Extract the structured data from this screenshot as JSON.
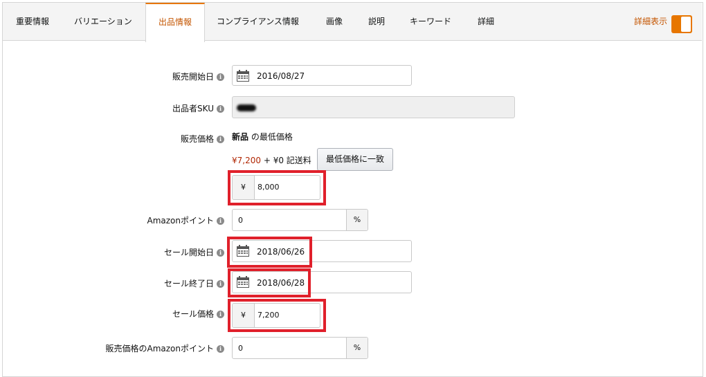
{
  "tabs": [
    {
      "label": "重要情報"
    },
    {
      "label": "バリエーション"
    },
    {
      "label": "出品情報",
      "active": true
    },
    {
      "label": "コンプライアンス情報"
    },
    {
      "label": "画像"
    },
    {
      "label": "説明"
    },
    {
      "label": "キーワード"
    },
    {
      "label": "詳細"
    }
  ],
  "detail_toggle": {
    "label": "詳細表示",
    "on": true,
    "color": "#e77600"
  },
  "form": {
    "release_date": {
      "label": "販売開始日",
      "value": "2016/08/27"
    },
    "seller_sku": {
      "label": "出品者SKU"
    },
    "price": {
      "label": "販売価格",
      "condition": "新品",
      "lowest_suffix": "の最低価格",
      "lowest_price": "¥7,200",
      "shipping": "+ ¥0 記送料",
      "match_button": "最低価格に一致",
      "currency": "¥",
      "value": "8,000"
    },
    "amazon_points": {
      "label": "Amazonポイント",
      "value": "0",
      "unit": "%"
    },
    "sale_start": {
      "label": "セール開始日",
      "value": "2018/06/26"
    },
    "sale_end": {
      "label": "セール終了日",
      "value": "2018/06/28"
    },
    "sale_price": {
      "label": "セール価格",
      "currency": "¥",
      "value": "7,200"
    },
    "price_points": {
      "label": "販売価格のAmazonポイント",
      "value": "0",
      "unit": "%"
    }
  },
  "colors": {
    "highlight": "#e0202b",
    "accent": "#c45500",
    "price_red": "#b12704"
  }
}
